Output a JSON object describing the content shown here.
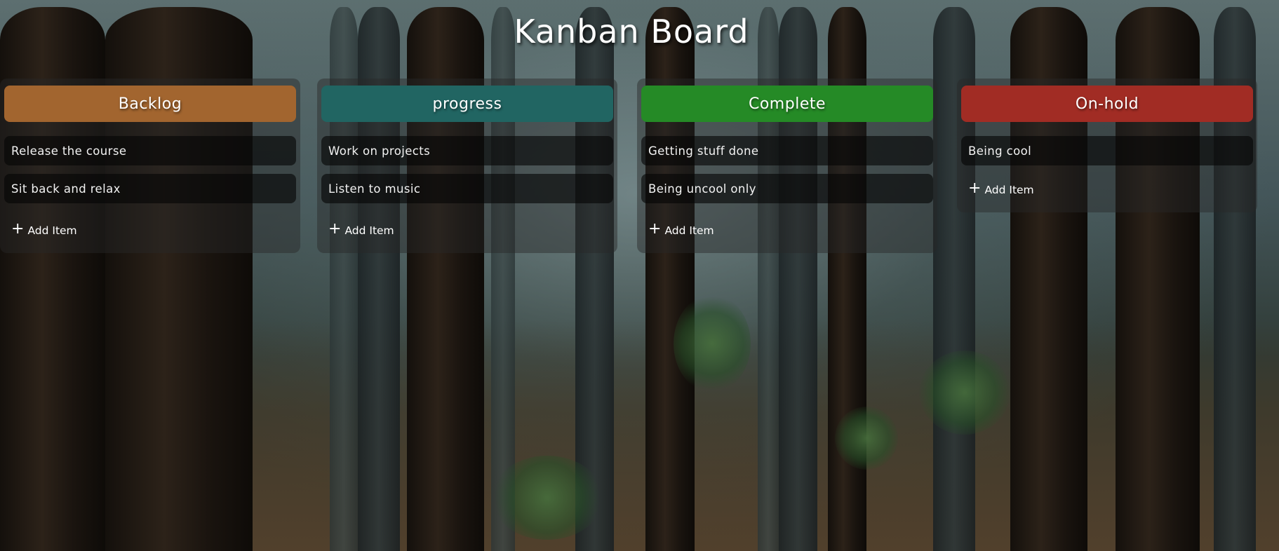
{
  "title": "Kanban Board",
  "add_item_label": "Add Item",
  "columns": [
    {
      "title": "Backlog",
      "color": "#a2652f",
      "items": [
        "Release the course",
        "Sit back and relax"
      ]
    },
    {
      "title": "progress",
      "color": "#216562",
      "items": [
        "Work on projects",
        "Listen to music"
      ]
    },
    {
      "title": "Complete",
      "color": "#258a26",
      "items": [
        "Getting stuff done",
        "Being uncool only"
      ]
    },
    {
      "title": "On-hold",
      "color": "#a12c24",
      "items": [
        "Being cool"
      ]
    }
  ]
}
